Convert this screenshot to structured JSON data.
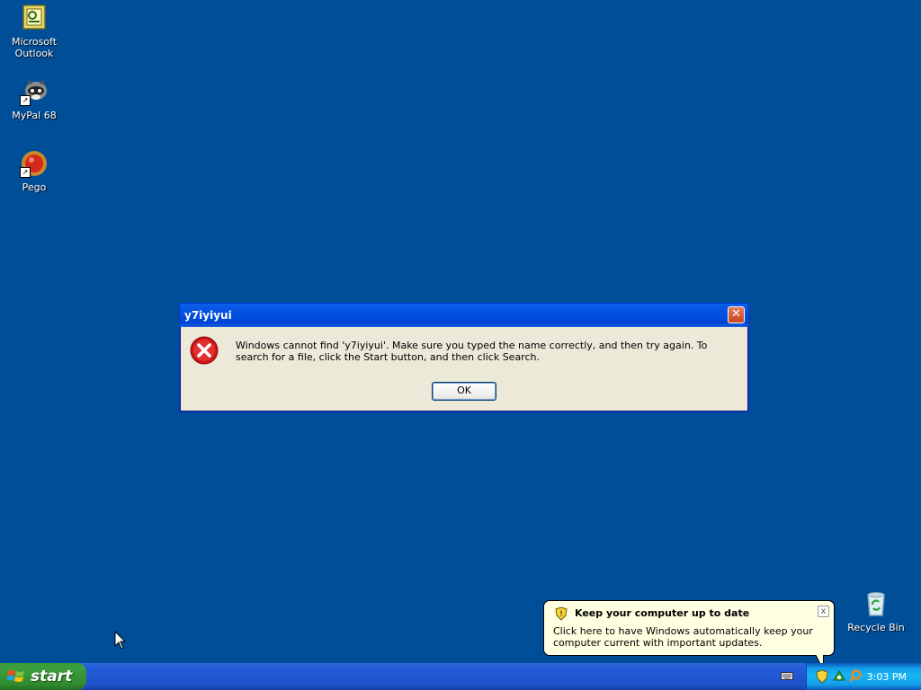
{
  "desktop": {
    "icons": [
      {
        "label_line1": "Microsoft",
        "label_line2": "Outlook",
        "icon": "outlook-icon"
      },
      {
        "label": "MyPal 68",
        "icon": "mypal-icon"
      },
      {
        "label": "Pego",
        "icon": "pego-icon"
      },
      {
        "label": "Recycle Bin",
        "icon": "recycle-bin-icon"
      }
    ]
  },
  "dialog": {
    "title": "y7iyiyui",
    "message": "Windows cannot find 'y7iyiyui'. Make sure you typed the name correctly, and then try again. To search for a file, click the Start button, and then click Search.",
    "ok_label": "OK",
    "close_label": "✕",
    "icon": "error-icon"
  },
  "balloon": {
    "title": "Keep your computer up to date",
    "text": "Click here to have Windows automatically keep your computer current with important updates.",
    "close_label": "x"
  },
  "taskbar": {
    "start_label": "start",
    "clock": "3:03 PM"
  },
  "colors": {
    "desktop": "#004E98",
    "taskbar": "#245EDB",
    "start": "#3D9F3D",
    "dialog_bg": "#ECE9D8",
    "balloon_bg": "#FFFFE1"
  }
}
